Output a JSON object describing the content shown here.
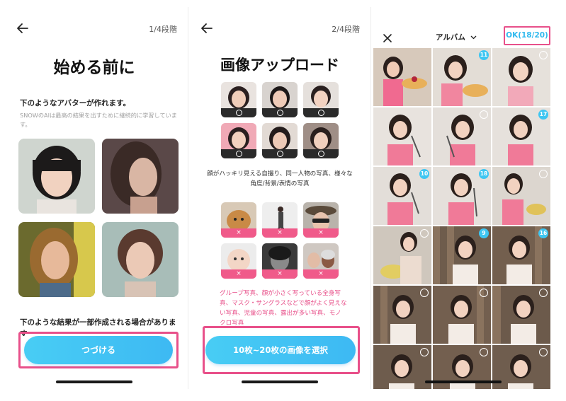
{
  "screen1": {
    "step": "1/4段階",
    "title": "始める前に",
    "subhead": "下のようなアバターが作れます。",
    "desc": "SNOWのAIは最高の結果を出すために継続的に学習しています。",
    "note": "下のような結果が一部作成される場合がありま す",
    "button": "つづける"
  },
  "screen2": {
    "step": "2/4段階",
    "title": "画像アップロード",
    "good_caption": "顔がハッキリ見える自撮り、同一人物の写真、様々な角度/背景/表情の写真",
    "bad_mark": "×",
    "warn_caption": "グループ写真、顔が小さく写っている全身写真、マスク・サングラスなどで顔がよく見えない写真、児童の写真、露出が多い写真、モノクロ写真",
    "button": "10枚~20枚の画像を選択"
  },
  "screen3": {
    "album_label": "アルバム",
    "ok_label": "OK(18/20)",
    "numbers": [
      "11",
      "17",
      "10",
      "18",
      "9",
      "16"
    ]
  },
  "icons": {
    "back": "arrow-left-icon",
    "close": "close-icon",
    "dropdown": "chevron-down-icon"
  },
  "colors": {
    "accent_pink": "#e8508a",
    "button_blue": "#48cdf4",
    "ok_blue": "#2fb9ee"
  }
}
